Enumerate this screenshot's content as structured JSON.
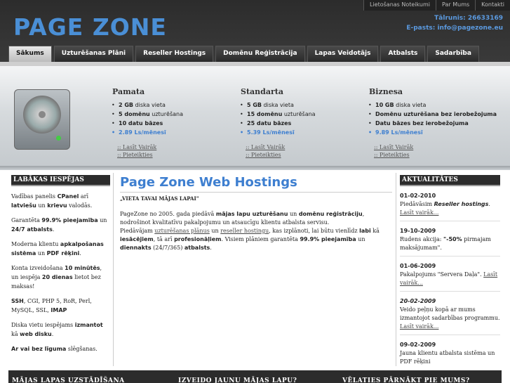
{
  "top_links": [
    "Lietošanas Noteikumi",
    "Par Mums",
    "Kontakti"
  ],
  "logo": "PAGE ZONE",
  "contact": {
    "phone": "Tālrunis: 26633169",
    "email": "E-pasts: info@pagezone.eu"
  },
  "nav": [
    "Sākums",
    "Uzturēšanas Plāni",
    "Reseller Hostings",
    "Domēnu Reģistrācija",
    "Lapas Veidotājs",
    "Atbalsts",
    "Sadarbība"
  ],
  "plans": [
    {
      "title": "Pamata",
      "items": [
        [
          "2 GB",
          " diska vieta"
        ],
        [
          "5 domēnu",
          " uzturēšana"
        ],
        [
          "10 datu bāzes",
          ""
        ]
      ],
      "price": "2.89 Ls/mēnesī",
      "links": [
        ":: Lasīt Vairāk",
        ":: Pieteikties"
      ]
    },
    {
      "title": "Standarta",
      "items": [
        [
          "5 GB",
          " diska vieta"
        ],
        [
          "15 domēnu",
          " uzturēšana"
        ],
        [
          "25 datu bāzes",
          ""
        ]
      ],
      "price": "5.39 Ls/mēnesī",
      "links": [
        ":: Lasīt Vairāk",
        ":: Pieteikties"
      ]
    },
    {
      "title": "Biznesa",
      "items": [
        [
          "10 GB",
          " diska vieta"
        ],
        [
          "Domēnu",
          " uzturēšana bez ierobežojuma"
        ],
        [
          "Datu bāzes bez ierobežojuma",
          ""
        ]
      ],
      "price": "9.89 Ls/mēnesī",
      "links": [
        ":: Lasīt Vairāk",
        ":: Pieteikties"
      ]
    }
  ],
  "left": {
    "title": "LABĀKAS IESPĒJAS",
    "p1": {
      "a": "Vadības panelis ",
      "b": "CPanel",
      "c": " arī ",
      "d": "latviešu",
      "e": " un ",
      "f": "krievu",
      "g": " valodās."
    },
    "p2": {
      "a": "Garantēta ",
      "b": "99.9% pieejamība",
      "c": " un ",
      "d": "24/7 atbalsts",
      "e": "."
    },
    "p3": {
      "a": "Moderna klientu ",
      "b": "apkalpošanas sistēma",
      "c": " un ",
      "d": "PDF rēķini",
      "e": "."
    },
    "p4": {
      "a": "Konta izveidošana ",
      "b": "10 minūtēs",
      "c": ", un iespēja ",
      "d": "20 dienas",
      "e": " lietot bez maksas!"
    },
    "p5": {
      "a": "SSH",
      "b": ", CGI, PHP 5, RoR, Perl, MySQL, SSL, ",
      "c": "IMAP"
    },
    "p6": {
      "a": "Diska vietu iespējams ",
      "b": "izmantot",
      "c": " kā ",
      "d": "web disku",
      "e": "."
    },
    "p7": {
      "a": "Ar vai bez līguma",
      "b": " slēgšanas."
    }
  },
  "main": {
    "title": "Page Zone Web Hostings",
    "slogan": "„VIETA TAVAI MĀJAS LAPAI”",
    "p1a": "PageZone no 2005. gada piedāvā ",
    "p1b": "mājas lapu uzturēšanu",
    "p1c": " un ",
    "p1d": "domēnu reģistrāciju",
    "p1e": ", nodrošinot kvalitatīvu pakalpojumu un atsaucīgu klientu atbalsta servisu.",
    "p2a": "Piedāvājam ",
    "p2b": "uzturēšanas plānus",
    "p2c": " un ",
    "p2d": "reseller hostingu",
    "p2e": ", kas izplānoti, lai būtu vienlīdz ",
    "p2f": "labi",
    "p2g": " kā ",
    "p2h": "iesācējiem",
    "p2i": ", tā arī ",
    "p2j": "profesionāļiem",
    "p2k": ". Visiem plāniem garantēta ",
    "p2l": "99.9% pieejamība",
    "p2m": " un ",
    "p2n": "diennakts",
    "p2o": " (24/7/365) ",
    "p2p": "atbalsts",
    "p2q": "."
  },
  "news": {
    "title": "AKTUALITĀTES",
    "items": [
      {
        "date": "01-02-2010",
        "a": "Piedāvāsim ",
        "b": "Reseller hostings",
        "c": ". ",
        "link": "Lasīt vairāk..."
      },
      {
        "date": "19-10-2009",
        "a": "Rudens akcija: ",
        "b": "\"-50%",
        "c": " pirmajam maksājumam\".",
        "link": ""
      },
      {
        "date": "01-06-2009",
        "a": "Pakalpojums \"Servera Daļa\". ",
        "b": "",
        "c": "",
        "link": "Lasīt vairāk..."
      },
      {
        "date": "20-02-2009",
        "a": "Veido peļņu kopā ar mums izmantojot sadarbības programmu. ",
        "b": "",
        "c": "",
        "link": "Lasīt vairāk..."
      },
      {
        "date": "09-02-2009",
        "a": "Jauna klientu atbalsta sistēma un PDF rēķini",
        "b": "",
        "c": "",
        "link": ""
      }
    ]
  },
  "footer": [
    "MĀJAS LAPAS UZSTĀDĪŠANA",
    "IZVEIDO JAUNU MĀJAS LAPU?",
    "VĒLATIES PĀRNĀKT PIE MUMS?"
  ]
}
